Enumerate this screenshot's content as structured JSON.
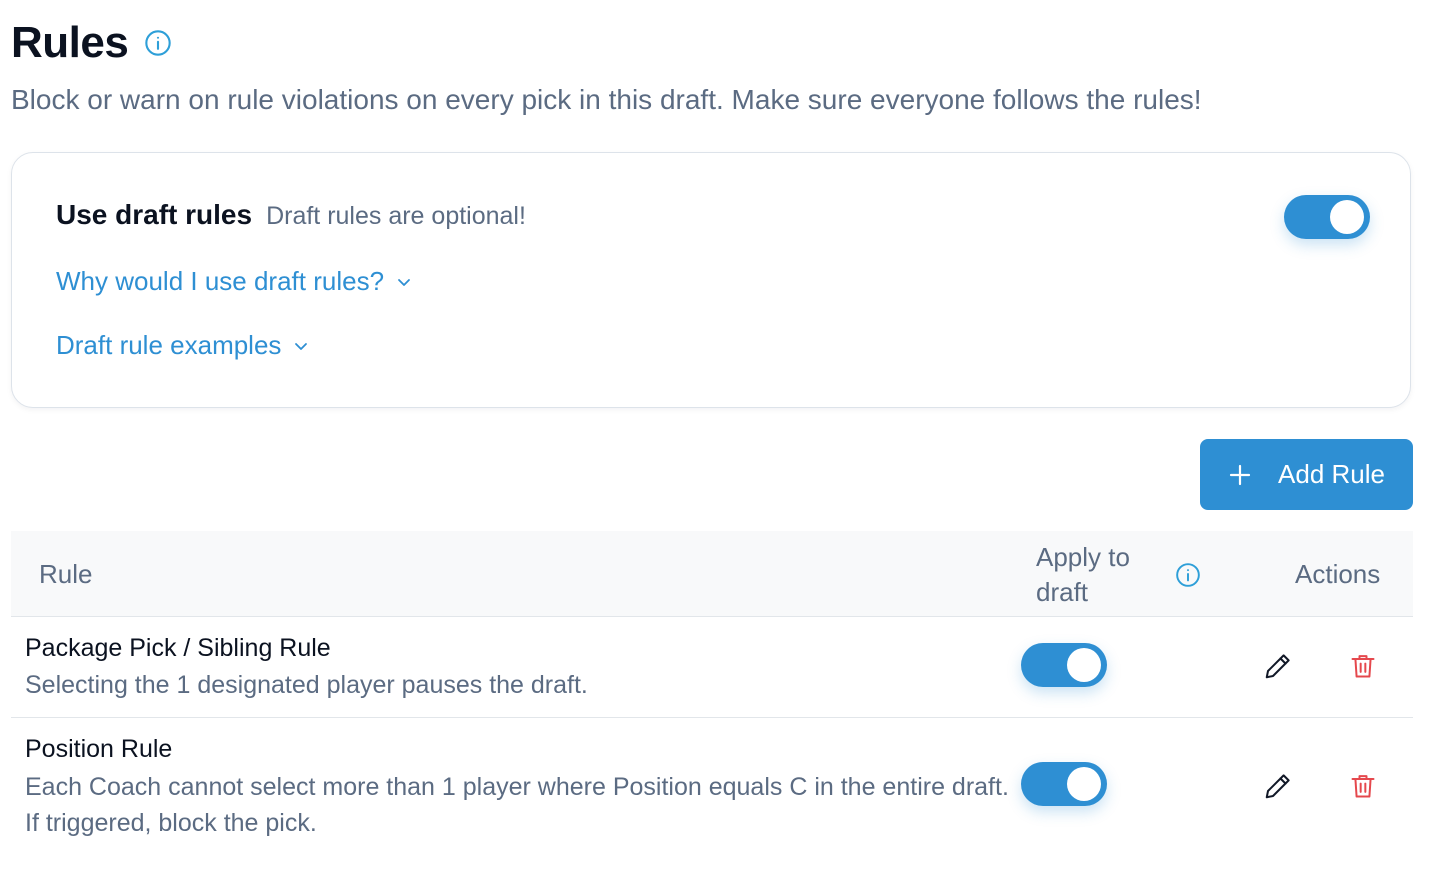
{
  "header": {
    "title": "Rules",
    "subtitle": "Block or warn on rule violations on every pick in this draft. Make sure everyone follows the rules!"
  },
  "settings_card": {
    "title": "Use draft rules",
    "subtitle": "Draft rules are optional!",
    "toggle_on": true,
    "links": [
      {
        "label": "Why would I use draft rules?"
      },
      {
        "label": "Draft rule examples"
      }
    ]
  },
  "toolbar": {
    "add_rule_label": "Add Rule"
  },
  "table": {
    "columns": {
      "rule": "Rule",
      "apply": "Apply to draft",
      "actions": "Actions"
    },
    "rows": [
      {
        "name": "Package Pick / Sibling Rule",
        "description": "Selecting the 1 designated player pauses the draft.",
        "apply_on": true
      },
      {
        "name": "Position Rule",
        "description": "Each Coach cannot select more than 1 player where Position equals C in the entire draft. If triggered, block the pick.",
        "apply_on": true
      }
    ]
  },
  "colors": {
    "accent": "#2e8fd3",
    "danger": "#e5484d",
    "muted_text": "#5b6b82"
  },
  "icons": {
    "title_info": "info-circle-icon",
    "column_info": "info-circle-icon",
    "link_chevron": "chevron-down-icon",
    "add": "plus-icon",
    "edit": "pencil-icon",
    "delete": "trash-icon"
  }
}
